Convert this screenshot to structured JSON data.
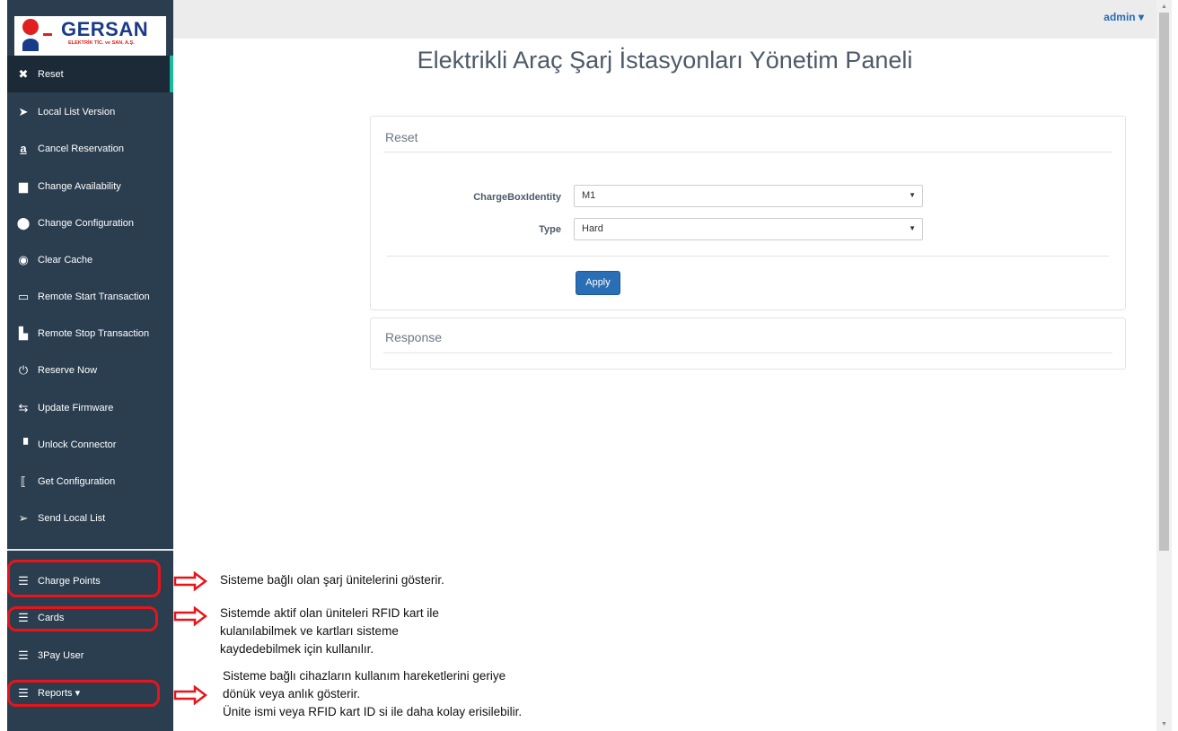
{
  "topbar": {
    "user_menu": "admin ▾"
  },
  "page_title": "Elektrikli Araç Şarj İstasyonları Yönetim Paneli",
  "logo": {
    "brand": "GERSAN",
    "subtitle": "ELEKTRİK TİC. ve SAN. A.Ş."
  },
  "sidebar": {
    "items": [
      {
        "label": "Reset",
        "icon": "x-icon",
        "glyph": "✖"
      },
      {
        "label": "Local List Version",
        "icon": "location-arrow-icon",
        "glyph": "➤"
      },
      {
        "label": "Cancel Reservation",
        "icon": "amazon-icon",
        "glyph": "a"
      },
      {
        "label": "Change Availability",
        "icon": "archive-icon",
        "glyph": "▆"
      },
      {
        "label": "Change Configuration",
        "icon": "android-icon",
        "glyph": "⬤"
      },
      {
        "label": "Clear Cache",
        "icon": "chrome-icon",
        "glyph": "◉"
      },
      {
        "label": "Remote Start Transaction",
        "icon": "desktop-icon",
        "glyph": "▭"
      },
      {
        "label": "Remote Stop Transaction",
        "icon": "files-icon",
        "glyph": "▙"
      },
      {
        "label": "Reserve Now",
        "icon": "empire-icon",
        "glyph": "⏻"
      },
      {
        "label": "Update Firmware",
        "icon": "usb-icon",
        "glyph": "⇆"
      },
      {
        "label": "Unlock Connector",
        "icon": "ticket-icon",
        "glyph": "▝"
      },
      {
        "label": "Get Configuration",
        "icon": "code-icon",
        "glyph": "⟦"
      },
      {
        "label": "Send Local List",
        "icon": "paper-plane-icon",
        "glyph": "➢"
      }
    ],
    "bottom_items": [
      {
        "label": "Charge Points",
        "icon": "list-icon",
        "glyph": "☰"
      },
      {
        "label": "Cards",
        "icon": "list-icon",
        "glyph": "☰"
      },
      {
        "label": "3Pay User",
        "icon": "list-icon",
        "glyph": "☰"
      },
      {
        "label": "Reports ▾",
        "icon": "list-icon",
        "glyph": "☰"
      }
    ]
  },
  "reset_panel": {
    "title": "Reset",
    "chargebox_label": "ChargeBoxIdentity",
    "chargebox_value": "M1",
    "type_label": "Type",
    "type_value": "Hard",
    "apply_label": "Apply"
  },
  "response_panel": {
    "title": "Response"
  },
  "annotations": {
    "charge_points": "Sisteme bağlı olan şarj ünitelerini gösterir.",
    "cards_lines": [
      "Sistemde aktif olan üniteleri RFID kart ile",
      "kulanılabilmek ve kartları sisteme",
      "kaydedebilmek için kullanılır."
    ],
    "reports_lines": [
      "Sisteme bağlı cihazların kullanım hareketlerini geriye",
      "dönük veya anlık gösterir.",
      "Ünite ismi veya RFID kart ID si ile daha kolay erisilebilir."
    ]
  },
  "colors": {
    "sidebar_bg": "#2b3e50",
    "accent": "#18bc9c",
    "primary_button": "#2a6fb5",
    "annotation_red": "#e8141a"
  }
}
